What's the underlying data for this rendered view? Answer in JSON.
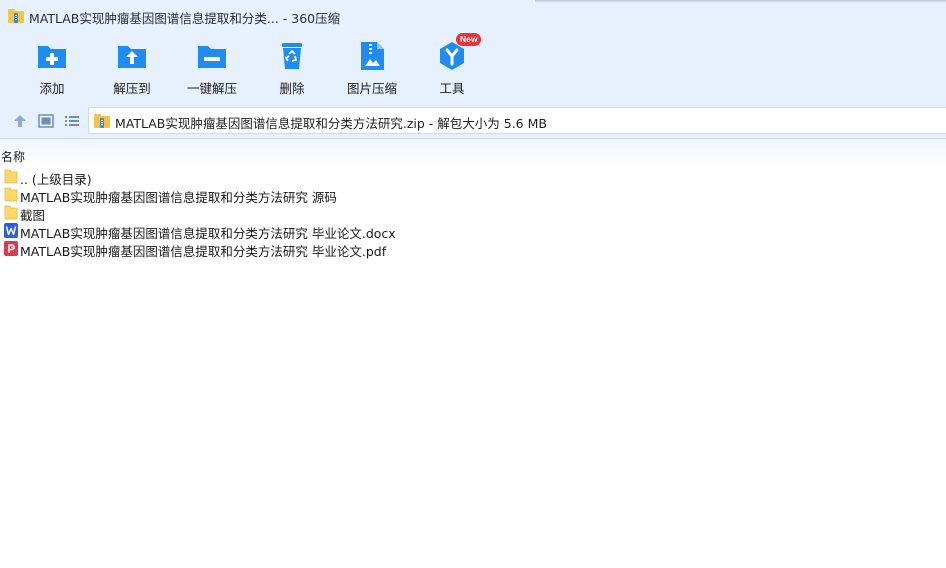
{
  "window": {
    "title": "MATLAB实现肿瘤基因图谱信息提取和分类... - 360压缩"
  },
  "toolbar": {
    "items": [
      {
        "label": "添加",
        "icon": "add-icon"
      },
      {
        "label": "解压到",
        "icon": "extract-to-icon"
      },
      {
        "label": "一键解压",
        "icon": "one-click-extract-icon"
      },
      {
        "label": "删除",
        "icon": "delete-icon"
      },
      {
        "label": "图片压缩",
        "icon": "image-compress-icon"
      },
      {
        "label": "工具",
        "icon": "tools-icon",
        "badge": "New"
      }
    ]
  },
  "nav": {
    "address": "MATLAB实现肿瘤基因图谱信息提取和分类方法研究.zip - 解包大小为 5.6 MB"
  },
  "list": {
    "header_name": "名称",
    "items": [
      {
        "name": ".. (上级目录)",
        "type": "folder"
      },
      {
        "name": "MATLAB实现肿瘤基因图谱信息提取和分类方法研究 源码",
        "type": "folder"
      },
      {
        "name": "截图",
        "type": "folder"
      },
      {
        "name": "MATLAB实现肿瘤基因图谱信息提取和分类方法研究 毕业论文.docx",
        "type": "word"
      },
      {
        "name": "MATLAB实现肿瘤基因图谱信息提取和分类方法研究 毕业论文.pdf",
        "type": "pdf"
      }
    ]
  },
  "colors": {
    "chrome_bg": "#e6f1fd",
    "icon_blue": "#1e8cf0",
    "badge_red": "#e8323c",
    "folder_yellow": "#fcd86b",
    "word_blue": "#2b5fe0",
    "pdf_red": "#e0374f"
  }
}
